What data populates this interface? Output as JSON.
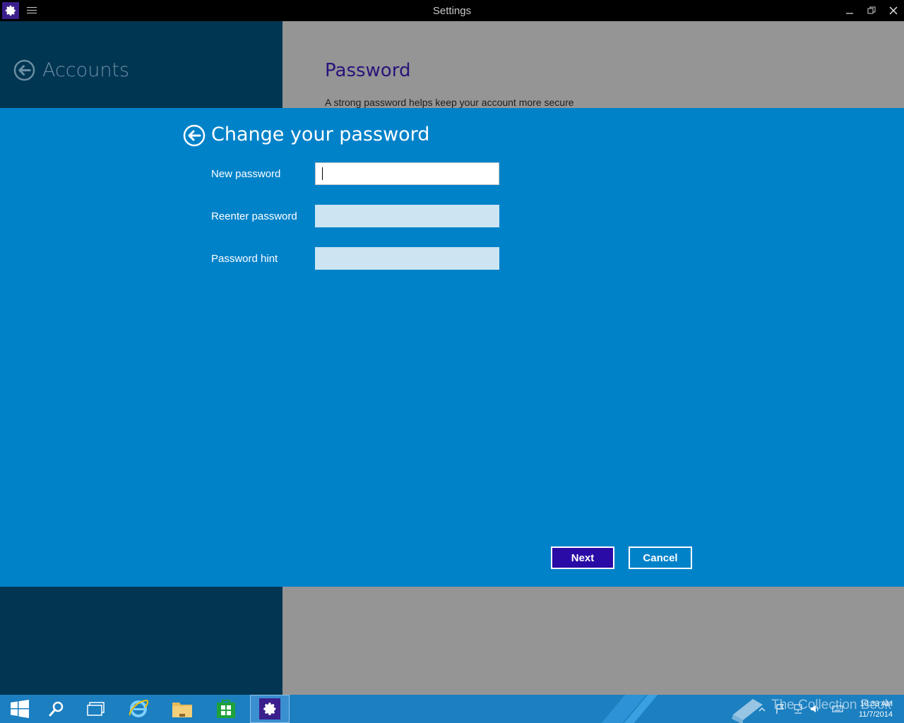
{
  "window": {
    "title": "Settings"
  },
  "background_app": {
    "section_title": "Accounts",
    "page_title": "Password",
    "page_description": "A strong password helps keep your account more secure"
  },
  "dialog": {
    "title": "Change your password",
    "fields": {
      "new_password": {
        "label": "New password",
        "value": ""
      },
      "reenter_password": {
        "label": "Reenter password",
        "value": ""
      },
      "password_hint": {
        "label": "Password hint",
        "value": ""
      }
    },
    "buttons": {
      "next": "Next",
      "cancel": "Cancel"
    }
  },
  "taskbar": {
    "items": [
      "start-icon",
      "search-icon",
      "task-view-icon",
      "internet-explorer-icon",
      "file-explorer-icon",
      "store-icon",
      "settings-icon"
    ],
    "active_item": "settings-icon",
    "watermark": "The Collection Book",
    "clock": {
      "time": "10:33 AM",
      "date": "11/7/2014"
    }
  },
  "colors": {
    "dialog_bg": "#0082c9",
    "next_button_bg": "#2a0ba6",
    "left_pane_bg": "#023552",
    "right_pane_bg": "#959595",
    "taskbar_bg": "#1b7fc0"
  }
}
